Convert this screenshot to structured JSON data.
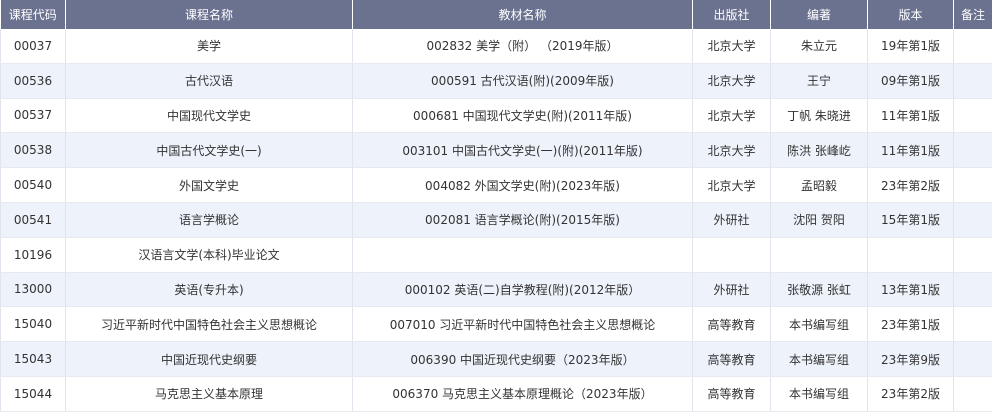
{
  "table": {
    "headers": [
      "课程代码",
      "课程名称",
      "教材名称",
      "出版社",
      "编著",
      "版本",
      "备注"
    ],
    "rows": [
      [
        "00037",
        "美学",
        "002832 美学（附） （2019年版）",
        "北京大学",
        "朱立元",
        "19年第1版",
        ""
      ],
      [
        "00536",
        "古代汉语",
        "000591 古代汉语(附)(2009年版)",
        "北京大学",
        "王宁",
        "09年第1版",
        ""
      ],
      [
        "00537",
        "中国现代文学史",
        "000681 中国现代文学史(附)(2011年版)",
        "北京大学",
        "丁帆 朱晓进",
        "11年第1版",
        ""
      ],
      [
        "00538",
        "中国古代文学史(一)",
        "003101 中国古代文学史(一)(附)(2011年版)",
        "北京大学",
        "陈洪 张峰屹",
        "11年第1版",
        ""
      ],
      [
        "00540",
        "外国文学史",
        "004082 外国文学史(附)(2023年版)",
        "北京大学",
        "孟昭毅",
        "23年第2版",
        ""
      ],
      [
        "00541",
        "语言学概论",
        "002081 语言学概论(附)(2015年版)",
        "外研社",
        "沈阳 贺阳",
        "15年第1版",
        ""
      ],
      [
        "10196",
        "汉语言文学(本科)毕业论文",
        "",
        "",
        "",
        "",
        ""
      ],
      [
        "13000",
        "英语(专升本)",
        "000102 英语(二)自学教程(附)(2012年版）",
        "外研社",
        "张敬源 张虹",
        "13年第1版",
        ""
      ],
      [
        "15040",
        "习近平新时代中国特色社会主义思想概论",
        "007010 习近平新时代中国特色社会主义思想概论",
        "高等教育",
        "本书编写组",
        "23年第1版",
        ""
      ],
      [
        "15043",
        "中国近现代史纲要",
        "006390 中国近现代史纲要（2023年版）",
        "高等教育",
        "本书编写组",
        "23年第9版",
        ""
      ],
      [
        "15044",
        "马克思主义基本原理",
        "006370 马克思主义基本原理概论（2023年版）",
        "高等教育",
        "本书编写组",
        "23年第2版",
        ""
      ]
    ]
  }
}
